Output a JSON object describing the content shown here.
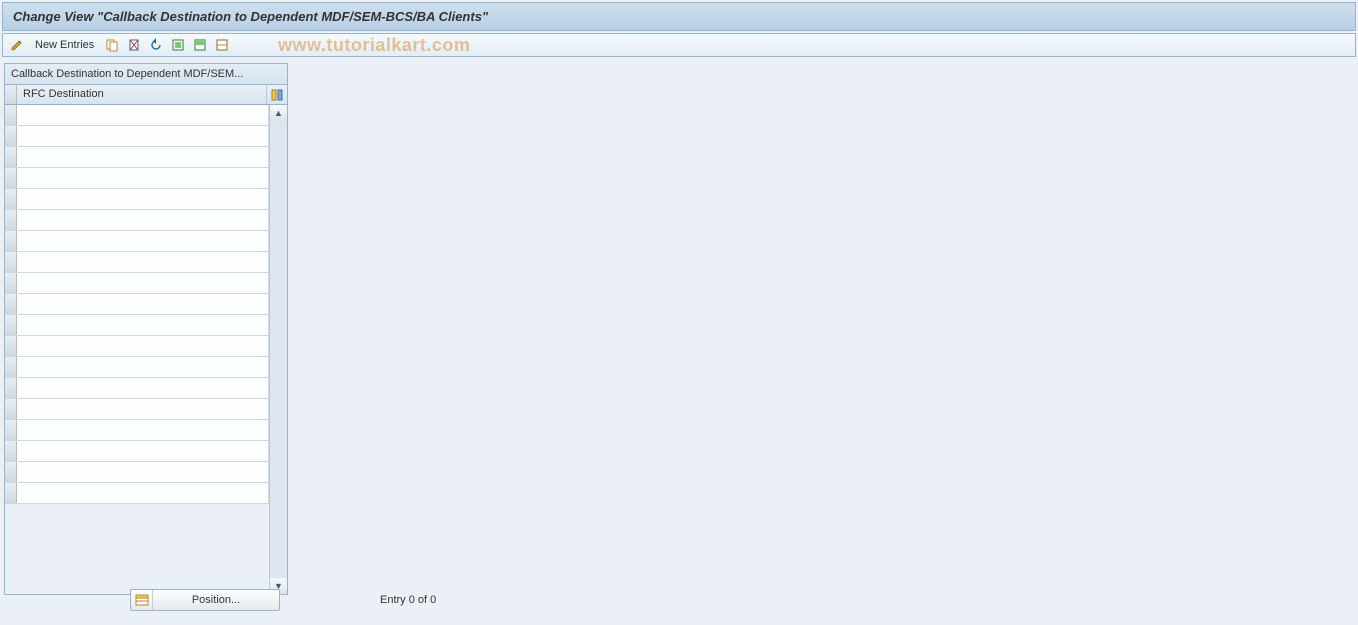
{
  "header": {
    "title": "Change View \"Callback Destination to Dependent MDF/SEM-BCS/BA Clients\""
  },
  "toolbar": {
    "new_entries_label": "New Entries"
  },
  "watermark": "www.tutorialkart.com",
  "panel": {
    "title": "Callback Destination to Dependent MDF/SEM...",
    "column_header": "RFC Destination",
    "row_count": 19
  },
  "footer": {
    "position_label": "Position...",
    "entry_text": "Entry 0 of 0"
  }
}
